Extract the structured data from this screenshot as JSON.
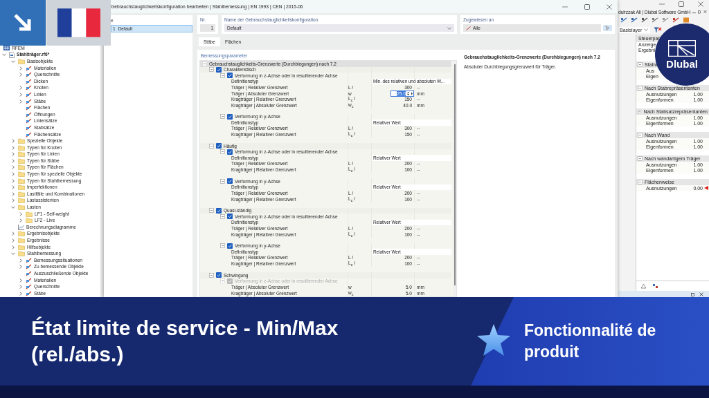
{
  "tree": {
    "items": [
      {
        "label": "RFEM",
        "kind": "app"
      },
      {
        "label": "Stahlträger.rf6*",
        "kind": "file",
        "expanded": true,
        "children": [
          {
            "label": "Basisobjekte",
            "kind": "folder",
            "expanded": true,
            "children": [
              {
                "label": "Materialien",
                "kind": "object",
                "expanded": false
              },
              {
                "label": "Querschnitte",
                "kind": "object",
                "expanded": false
              },
              {
                "label": "Dicken",
                "kind": "object"
              },
              {
                "label": "Knoten",
                "kind": "object",
                "expanded": false
              },
              {
                "label": "Linien",
                "kind": "object",
                "expanded": false
              },
              {
                "label": "Stäbe",
                "kind": "object",
                "expanded": false
              },
              {
                "label": "Flächen",
                "kind": "object"
              },
              {
                "label": "Öffnungen",
                "kind": "object"
              },
              {
                "label": "Liniensätze",
                "kind": "object"
              },
              {
                "label": "Stabsätze",
                "kind": "object"
              },
              {
                "label": "Flächensätze",
                "kind": "object"
              }
            ]
          },
          {
            "label": "Spezielle Objekte",
            "kind": "folder",
            "expanded": false
          },
          {
            "label": "Typen für Knoten",
            "kind": "folder",
            "expanded": false
          },
          {
            "label": "Typen für Linien",
            "kind": "folder",
            "expanded": false
          },
          {
            "label": "Typen für Stäbe",
            "kind": "folder",
            "expanded": false
          },
          {
            "label": "Typen für Flächen",
            "kind": "folder",
            "expanded": false
          },
          {
            "label": "Typen für spezielle Objekte",
            "kind": "folder",
            "expanded": false
          },
          {
            "label": "Typen für Stahlbemessung",
            "kind": "folder",
            "expanded": false
          },
          {
            "label": "Imperfektionen",
            "kind": "folder",
            "expanded": false
          },
          {
            "label": "Lastfälle und Kombinationen",
            "kind": "folder",
            "expanded": false
          },
          {
            "label": "Lastassistenten",
            "kind": "folder",
            "expanded": false
          },
          {
            "label": "Lasten",
            "kind": "folder",
            "expanded": true,
            "children": [
              {
                "label": "LF1 - Self-weight",
                "kind": "folder",
                "expanded": false
              },
              {
                "label": "LF2 - Live",
                "kind": "folder",
                "expanded": false
              }
            ]
          },
          {
            "label": "Berechnungsdiagramme",
            "kind": "chart"
          },
          {
            "label": "Ergebnisobjekte",
            "kind": "folder",
            "expanded": false
          },
          {
            "label": "Ergebnisse",
            "kind": "folder",
            "expanded": false
          },
          {
            "label": "Hilfsobjekte",
            "kind": "folder",
            "expanded": false
          },
          {
            "label": "Stahlbemessung",
            "kind": "folder",
            "expanded": true,
            "children": [
              {
                "label": "Bemessungssituationen",
                "kind": "object",
                "expanded": false
              },
              {
                "label": "Zu bemessende Objekte",
                "kind": "object",
                "expanded": false
              },
              {
                "label": "Auszuschließende Objekte",
                "kind": "object"
              },
              {
                "label": "Materialien",
                "kind": "object",
                "expanded": false
              },
              {
                "label": "Querschnitte",
                "kind": "object",
                "expanded": false
              },
              {
                "label": "Stäbe",
                "kind": "object",
                "expanded": false
              }
            ]
          }
        ]
      }
    ]
  },
  "dialog": {
    "title": "Gebrauchstauglichkeitskonfiguration bearbeiten | Stahlbemessung | EN 1993 | CEN | 2015-06",
    "list": {
      "header": "e",
      "rows": [
        {
          "number": "1",
          "name": "Default",
          "selected": true
        }
      ]
    },
    "number": {
      "label": "Nr.",
      "value": "1"
    },
    "name_field": {
      "label": "Name der Gebrauchstauglichkeitskonfiguration",
      "value": "Default"
    },
    "assigned": {
      "label": "Zugewiesen an",
      "value": "Alle"
    },
    "tabs": [
      {
        "label": "Stäbe",
        "selected": true
      },
      {
        "label": "Flächen",
        "selected": false
      }
    ],
    "grid": {
      "header": "Bemessungsparameter",
      "title": "Gebrauchstauglichkeits-Grenzwerte (Durchbiegungen) nach 7.2",
      "expanded": true,
      "groups": [
        {
          "label": "Charakteristisch",
          "checked": true,
          "expanded": true,
          "children": [
            {
              "label": "Verformung in z-Achse oder in resultierender Achse",
              "checked": true,
              "disabled": false,
              "expanded": true,
              "rows": [
                {
                  "kind": "definition",
                  "label": "Definitionstyp",
                  "value": "Min. des relativen und absoluten W..."
                },
                {
                  "kind": "limit",
                  "label": "Träger | Relativer Grenzwert",
                  "symbol": "L /",
                  "value": "300",
                  "unit": "--",
                  "editing": false
                },
                {
                  "kind": "limit",
                  "label": "Träger | Absoluter Grenzwert",
                  "symbol": "w",
                  "value": "25.0",
                  "unit": "mm",
                  "editing": true
                },
                {
                  "kind": "limit",
                  "label": "Kragträger | Relativer Grenzwert",
                  "symbol": "L$_{c}$ /",
                  "value": "150",
                  "unit": "--",
                  "editing": false
                },
                {
                  "kind": "limit",
                  "label": "Kragträger | Absoluter Grenzwert",
                  "symbol": "w$_{c}$",
                  "value": "40.0",
                  "unit": "mm",
                  "editing": false
                }
              ]
            },
            {
              "label": "Verformung in y-Achse",
              "checked": true,
              "disabled": false,
              "expanded": true,
              "rows": [
                {
                  "kind": "definition",
                  "label": "Definitionstyp",
                  "value": "Relativer Wert"
                },
                {
                  "kind": "limit",
                  "label": "Träger | Relativer Grenzwert",
                  "symbol": "L /",
                  "value": "300",
                  "unit": "--",
                  "editing": false
                },
                {
                  "kind": "limit",
                  "label": "Kragträger | Relativer Grenzwert",
                  "symbol": "L$_{c}$ /",
                  "value": "150",
                  "unit": "--",
                  "editing": false
                }
              ]
            }
          ]
        },
        {
          "label": "Häufig",
          "checked": true,
          "expanded": true,
          "children": [
            {
              "label": "Verformung in z-Achse oder in resultierender Achse",
              "checked": true,
              "disabled": false,
              "expanded": true,
              "rows": [
                {
                  "kind": "definition",
                  "label": "Definitionstyp",
                  "value": "Relativer Wert"
                },
                {
                  "kind": "limit",
                  "label": "Träger | Relativer Grenzwert",
                  "symbol": "L /",
                  "value": "200",
                  "unit": "--",
                  "editing": false
                },
                {
                  "kind": "limit",
                  "label": "Kragträger | Relativer Grenzwert",
                  "symbol": "L$_{c}$ /",
                  "value": "100",
                  "unit": "--",
                  "editing": false
                }
              ]
            },
            {
              "label": "Verformung in y-Achse",
              "checked": true,
              "disabled": false,
              "expanded": true,
              "rows": [
                {
                  "kind": "definition",
                  "label": "Definitionstyp",
                  "value": "Relativer Wert"
                },
                {
                  "kind": "limit",
                  "label": "Träger | Relativer Grenzwert",
                  "symbol": "L /",
                  "value": "200",
                  "unit": "--",
                  "editing": false
                },
                {
                  "kind": "limit",
                  "label": "Kragträger | Relativer Grenzwert",
                  "symbol": "L$_{c}$ /",
                  "value": "100",
                  "unit": "--",
                  "editing": false
                }
              ]
            }
          ]
        },
        {
          "label": "Quasi-ständig",
          "checked": true,
          "expanded": true,
          "children": [
            {
              "label": "Verformung in z-Achse oder in resultierender Achse",
              "checked": true,
              "disabled": false,
              "expanded": true,
              "rows": [
                {
                  "kind": "definition",
                  "label": "Definitionstyp",
                  "value": "Relativer Wert"
                },
                {
                  "kind": "limit",
                  "label": "Träger | Relativer Grenzwert",
                  "symbol": "L /",
                  "value": "200",
                  "unit": "--",
                  "editing": false
                },
                {
                  "kind": "limit",
                  "label": "Kragträger | Relativer Grenzwert",
                  "symbol": "L$_{c}$ /",
                  "value": "100",
                  "unit": "--",
                  "editing": false
                }
              ]
            },
            {
              "label": "Verformung in y-Achse",
              "checked": true,
              "disabled": false,
              "expanded": true,
              "rows": [
                {
                  "kind": "definition",
                  "label": "Definitionstyp",
                  "value": "Relativer Wert"
                },
                {
                  "kind": "limit",
                  "label": "Träger | Relativer Grenzwert",
                  "symbol": "L /",
                  "value": "200",
                  "unit": "--",
                  "editing": false
                },
                {
                  "kind": "limit",
                  "label": "Kragträger | Relativer Grenzwert",
                  "symbol": "L$_{c}$ /",
                  "value": "100",
                  "unit": "--",
                  "editing": false
                }
              ]
            }
          ]
        },
        {
          "label": "Schwingung",
          "checked": true,
          "expanded": true,
          "children": [
            {
              "label": "Verformung in z-Achse oder in resultierender Achse",
              "checked": true,
              "disabled": true,
              "expanded": true,
              "rows": [
                {
                  "kind": "limit",
                  "label": "Träger | Absoluter Grenzwert",
                  "symbol": "w",
                  "value": "5.0",
                  "unit": "mm",
                  "editing": false
                },
                {
                  "kind": "limit",
                  "label": "Kragträger | Absoluter Grenzwert",
                  "symbol": "w$_{c}$",
                  "value": "5.0",
                  "unit": "mm",
                  "editing": false
                }
              ]
            }
          ]
        }
      ]
    },
    "description": {
      "title": "Gebrauchstauglichkeits-Grenzwerte (Durchbiegungen) nach 7.2",
      "text": "Absoluter Durchbiegungsgrenzwert für Träger."
    }
  },
  "app": {
    "title": "dulrzzak Ali | Dlubal Software GmbH",
    "layer": "Basislayer",
    "panel": {
      "title": "Steuerpan",
      "lines": [
        "Anzeige",
        "Ergebni"
      ],
      "sections": [
        {
          "title": "Stabw",
          "rows": [
            {
              "label": "Aus",
              "marked": false
            },
            {
              "label": "Eigen",
              "marked": false
            }
          ]
        },
        {
          "title": "Nach Stabrepräsentanten",
          "rows": [
            {
              "label": "Ausnutzungen",
              "value": "1.00",
              "marked": false
            },
            {
              "label": "Eigenformen",
              "value": "1.00",
              "marked": false
            }
          ]
        },
        {
          "title": "Nach Stabsatzrepräsentanten",
          "rows": [
            {
              "label": "Ausnutzungen",
              "value": "1.00",
              "marked": false
            },
            {
              "label": "Eigenformen",
              "value": "1.00",
              "marked": false
            }
          ]
        },
        {
          "title": "Nach Wand",
          "rows": [
            {
              "label": "Ausnutzungen",
              "value": "1.00",
              "marked": false
            },
            {
              "label": "Eigenformen",
              "value": "1.00",
              "marked": false
            }
          ]
        },
        {
          "title": "Nach wandartigem Träger",
          "rows": [
            {
              "label": "Ausnutzungen",
              "value": "1.00",
              "marked": false
            },
            {
              "label": "Eigenformen",
              "value": "1.00",
              "marked": false
            }
          ]
        },
        {
          "title": "Flächenweise",
          "rows": [
            {
              "label": "Ausnutzungen",
              "value": "0.00",
              "marked": true
            }
          ]
        }
      ]
    }
  },
  "logo": {
    "text": "Dlubal"
  },
  "banner": {
    "title": "État limite de service - Min/Max (rel./abs.)",
    "tagline": "Fonctionnalité de produit"
  }
}
